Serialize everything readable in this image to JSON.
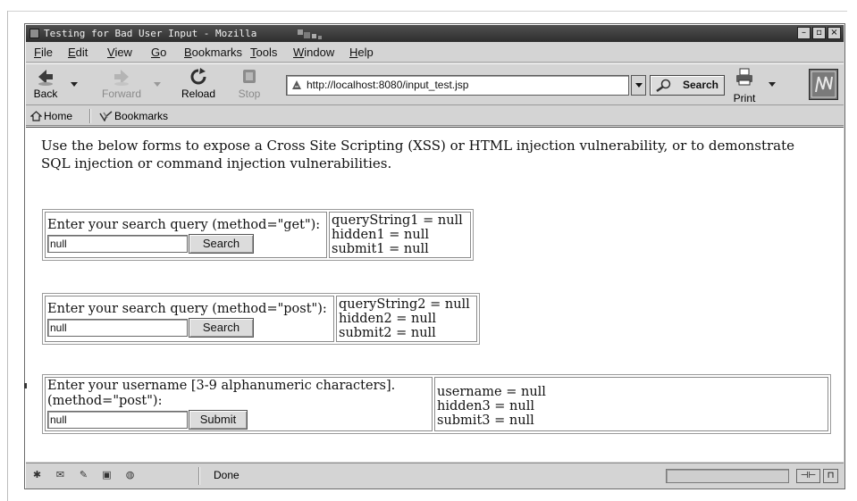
{
  "window": {
    "title": "Testing for Bad User Input - Mozilla",
    "controls": {
      "minimize": "–",
      "maximize": "▫",
      "close": "×"
    }
  },
  "menubar": {
    "items": [
      {
        "label": "File",
        "mnemonic": "F",
        "rest": "ile"
      },
      {
        "label": "Edit",
        "mnemonic": "E",
        "rest": "dit"
      },
      {
        "label": "View",
        "mnemonic": "V",
        "rest": "iew"
      },
      {
        "label": "Go",
        "mnemonic": "G",
        "rest": "o"
      },
      {
        "label": "Bookmarks",
        "mnemonic": "B",
        "rest": "ookmarks"
      },
      {
        "label": "Tools",
        "mnemonic": "T",
        "rest": "ools"
      },
      {
        "label": "Window",
        "mnemonic": "W",
        "rest": "indow"
      },
      {
        "label": "Help",
        "mnemonic": "H",
        "rest": "elp"
      }
    ]
  },
  "toolbar": {
    "back_label": "Back",
    "forward_label": "Forward",
    "reload_label": "Reload",
    "stop_label": "Stop",
    "url": "http://localhost:8080/input_test.jsp",
    "search_label": "Search",
    "print_label": "Print"
  },
  "personal_toolbar": {
    "home_label": "Home",
    "bookmarks_label": "Bookmarks"
  },
  "page": {
    "intro": "Use the below forms to expose a Cross Site Scripting (XSS) or HTML injection vulnerability, or to demonstrate SQL injection or command injection vulnerabilities.",
    "form1": {
      "prompt": "Enter your search query (method=\"get\"):",
      "input_value": "null",
      "button_label": "Search",
      "results": [
        "queryString1 = null",
        "hidden1 = null",
        "submit1 = null"
      ]
    },
    "form2": {
      "prompt": "Enter your search query (method=\"post\"):",
      "input_value": "null",
      "button_label": "Search",
      "results": [
        "queryString2 = null",
        "hidden2 = null",
        "submit2 = null"
      ]
    },
    "form3": {
      "prompt_line1": "Enter your username [3-9 alphanumeric characters].",
      "prompt_line2": "(method=\"post\"):",
      "input_value": "null",
      "button_label": "Submit",
      "results": [
        "username = null",
        "hidden3 = null",
        "submit3 = null"
      ]
    }
  },
  "statusbar": {
    "status_text": "Done",
    "icons": [
      "navigator-icon",
      "mail-icon",
      "composer-icon",
      "address-book-icon",
      "irc-chat-icon"
    ]
  },
  "colors": {
    "titlebar": "#3a3a3a",
    "chrome": "#d4d4d4",
    "content_bg": "#ffffff"
  }
}
